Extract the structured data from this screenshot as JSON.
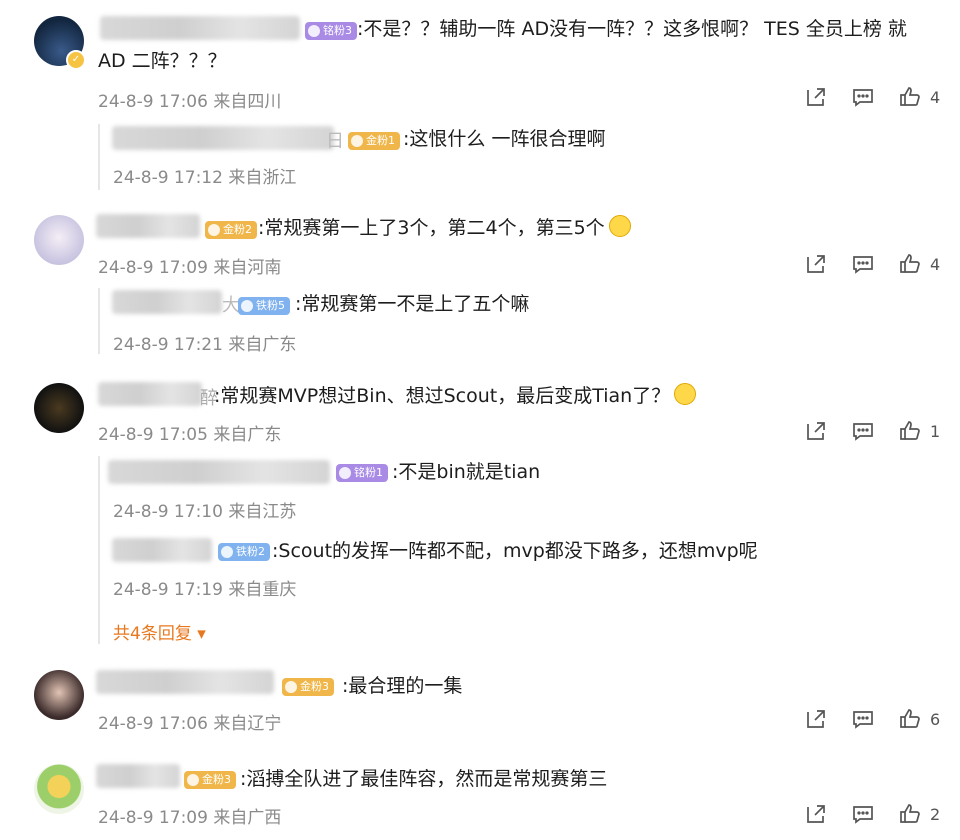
{
  "comments": [
    {
      "badge": "铭粉3",
      "text1": ":不是？？辅助一阵 AD没有一阵？？这多恨啊？ TES 全员上榜 就",
      "text2": "AD 二阵？？？",
      "time": "24-8-9 17:06 来自四川",
      "likes": "4",
      "replies": [
        {
          "badge": "金粉1",
          "trail": "日",
          "text": ":这恨什么 一阵很合理啊",
          "time": "24-8-9 17:12 来自浙江"
        }
      ]
    },
    {
      "badge": "金粉2",
      "text1": ":常规赛第一上了3个，第二4个，第三5个",
      "time": "24-8-9 17:09 来自河南",
      "likes": "4",
      "replies": [
        {
          "badge": "铁粉5",
          "trail": "大",
          "text": ":常规赛第一不是上了五个嘛",
          "time": "24-8-9 17:21 来自广东"
        }
      ]
    },
    {
      "name_fragment": "醉",
      "text1": ":常规赛MVP想过Bin、想过Scout，最后变成Tian了？",
      "time": "24-8-9 17:05 来自广东",
      "likes": "1",
      "replies": [
        {
          "badge": "铭粉1",
          "text": ":不是bin就是tian",
          "time": "24-8-9 17:10 来自江苏"
        },
        {
          "badge": "铁粉2",
          "text": ":Scout的发挥一阵都不配，mvp都没下路多，还想mvp呢",
          "time": "24-8-9 17:19 来自重庆"
        }
      ],
      "more_replies": "共4条回复"
    },
    {
      "badge": "金粉3",
      "text1": ":最合理的一集",
      "time": "24-8-9 17:06 来自辽宁",
      "likes": "6"
    },
    {
      "badge": "金粉3",
      "text1": ":滔搏全队进了最佳阵容，然而是常规赛第三",
      "time": "24-8-9 17:09 来自广西",
      "likes": "2"
    }
  ],
  "icons": {
    "share": "share-icon",
    "comment": "comment-icon",
    "like": "thumbs-up-icon"
  },
  "colors": {
    "meta": "#8a8a8a",
    "more_link": "#e8781e",
    "badge_gold": "#f0b64a",
    "badge_purple": "#a98be6",
    "badge_blue": "#7fb2ee"
  }
}
